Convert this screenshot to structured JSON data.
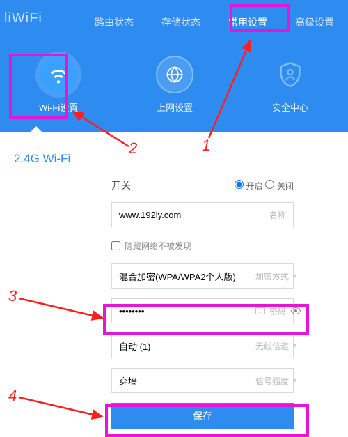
{
  "logo": "liWiFi",
  "topnav": {
    "items": [
      "路由状态",
      "存储状态",
      "常用设置",
      "高级设置"
    ],
    "activeIndex": 2
  },
  "iconrow": {
    "items": [
      {
        "label": "Wi-Fi设置",
        "icon": "wifi-icon",
        "active": true
      },
      {
        "label": "上网设置",
        "icon": "globe-icon",
        "active": false
      },
      {
        "label": "安全中心",
        "icon": "shield-icon",
        "active": false
      }
    ]
  },
  "section_title": "2.4G Wi-Fi",
  "form": {
    "switch_label": "开关",
    "switch_on": "开启",
    "switch_off": "关闭",
    "name_value": "www.192ly.com",
    "name_suffix": "名称",
    "hide_label": "隐藏网络不被发现",
    "encryption_value": "混合加密(WPA/WPA2个人版)",
    "encryption_suffix": "加密方式",
    "password_value": "••••••••",
    "password_suffix": "密码",
    "channel_value": "自动 (1)",
    "channel_suffix": "无线信道",
    "strength_value": "穿墙",
    "strength_suffix": "信号强度",
    "save_label": "保存"
  },
  "annotations": {
    "n1": "1",
    "n2": "2",
    "n3": "3",
    "n4": "4"
  }
}
